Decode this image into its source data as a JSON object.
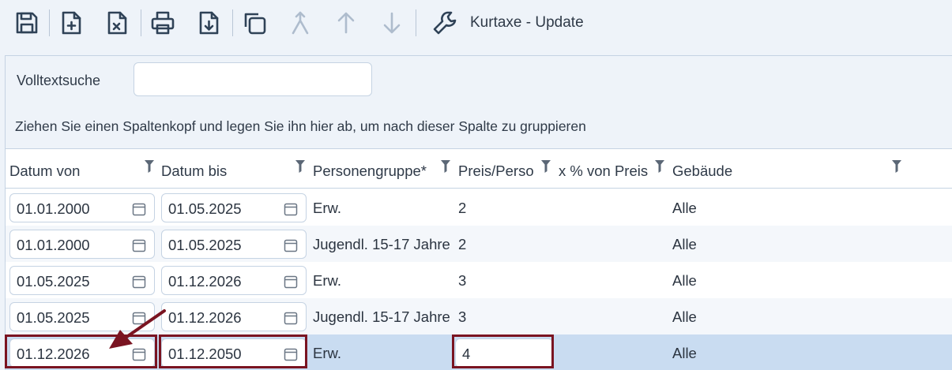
{
  "toolbar": {
    "title": "Kurtaxe - Update",
    "icons": [
      "save-icon",
      "new-document-icon",
      "delete-document-icon",
      "print-icon",
      "download-icon",
      "copy-icon",
      "merge-icon",
      "arrow-up-icon",
      "arrow-down-icon",
      "wrench-icon"
    ]
  },
  "search": {
    "label": "Volltextsuche",
    "value": "",
    "placeholder": ""
  },
  "group_hint": "Ziehen Sie einen Spaltenkopf und legen Sie ihn hier ab, um nach dieser Spalte zu gruppieren",
  "columns": {
    "datum_von": "Datum von",
    "datum_bis": "Datum bis",
    "personengruppe": "Personengruppe*",
    "preis": "Preis/Perso",
    "prozent": "x % von Preis",
    "gebaeude": "Gebäude"
  },
  "rows": [
    {
      "datum_von": "01.01.2000",
      "datum_bis": "01.05.2025",
      "personengruppe": "Erw.",
      "preis": "2",
      "gebaeude": "Alle"
    },
    {
      "datum_von": "01.01.2000",
      "datum_bis": "01.05.2025",
      "personengruppe": "Jugendl. 15-17 Jahre",
      "preis": "2",
      "gebaeude": "Alle"
    },
    {
      "datum_von": "01.05.2025",
      "datum_bis": "01.12.2026",
      "personengruppe": "Erw.",
      "preis": "3",
      "gebaeude": "Alle"
    },
    {
      "datum_von": "01.05.2025",
      "datum_bis": "01.12.2026",
      "personengruppe": "Jugendl. 15-17 Jahre",
      "preis": "3",
      "gebaeude": "Alle"
    },
    {
      "datum_von": "01.12.2026",
      "datum_bis": "01.12.2050",
      "personengruppe": "Erw.",
      "preis": "4",
      "gebaeude": "Alle"
    }
  ],
  "colors": {
    "highlight": "#7a1421",
    "selected_row": "#c9dcf1",
    "toolbar_bg": "#eef3f9",
    "icon": "#2f4257",
    "icon_disabled": "#aebccd"
  }
}
